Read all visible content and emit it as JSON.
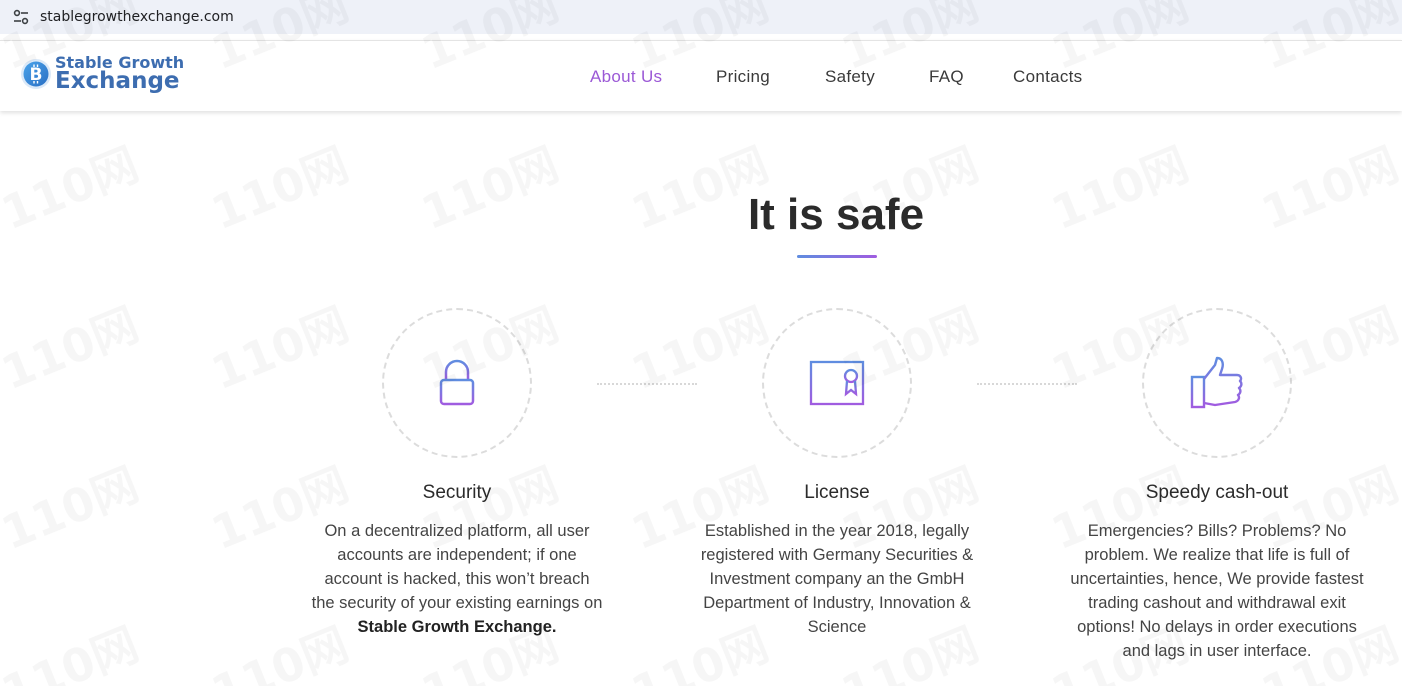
{
  "browser": {
    "url": "stablegrowthexchange.com",
    "icon": "site-settings-icon"
  },
  "header": {
    "logo": {
      "line1": "Stable Growth",
      "line2": "Exchange",
      "icon": "bitcoin-coin-icon",
      "color": "#3d6db0"
    },
    "nav": [
      {
        "label": "About Us",
        "active": true
      },
      {
        "label": "Pricing",
        "active": false
      },
      {
        "label": "Safety",
        "active": false
      },
      {
        "label": "FAQ",
        "active": false
      },
      {
        "label": "Contacts",
        "active": false
      }
    ],
    "active_color": "#9b59d6"
  },
  "section": {
    "title": "It is safe",
    "features": [
      {
        "icon": "padlock-icon",
        "title": "Security",
        "desc_lines": [
          "On a decentralized platform, all user",
          "accounts are independent; if one",
          "account is hacked, this won’t breach",
          "the security of your existing earnings on"
        ],
        "desc_bold": "Stable Growth Exchange."
      },
      {
        "icon": "certificate-icon",
        "title": "License",
        "desc_lines": [
          "Established in the year 2018, legally",
          "registered with Germany Securities &",
          "Investment company an the GmbH",
          "Department of Industry, Innovation &",
          "Science"
        ]
      },
      {
        "icon": "thumbs-up-icon",
        "title": "Speedy cash-out",
        "desc_lines": [
          "Emergencies? Bills? Problems? No",
          "problem. We realize that life is full of",
          "uncertainties, hence, We provide fastest",
          "trading cashout and withdrawal exit",
          "options! No delays in order executions",
          "and lags in user interface."
        ]
      }
    ],
    "icon_gradient": [
      "#5f8de0",
      "#a05ce0"
    ]
  },
  "watermark": {
    "text": "110网"
  }
}
